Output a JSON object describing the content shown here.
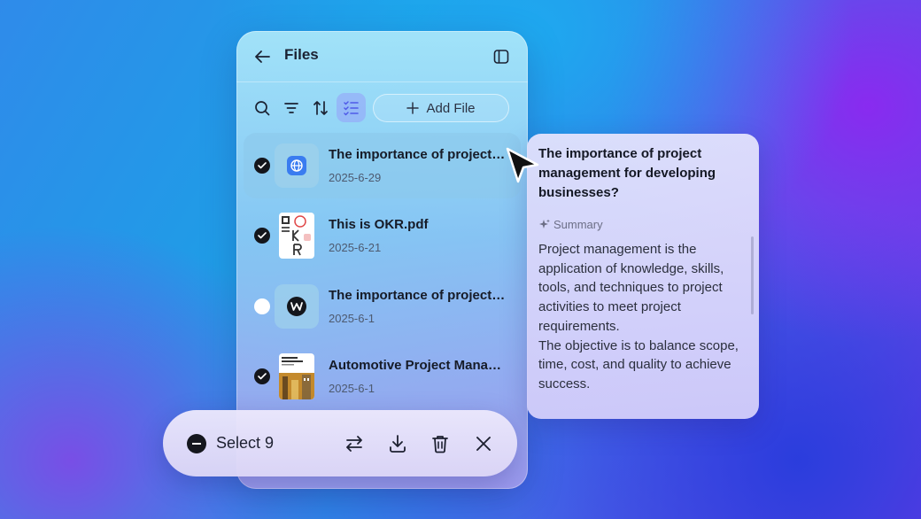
{
  "panel": {
    "title": "Files",
    "add_file_label": "Add File"
  },
  "files": [
    {
      "name": "The importance of project management for developing businesses?",
      "date": "2025-6-29",
      "checked": true,
      "thumb": "globe-app-icon"
    },
    {
      "name": "This is OKR.pdf",
      "date": "2025-6-21",
      "checked": true,
      "thumb": "okr-pdf-thumbnail"
    },
    {
      "name": "The importance of project management",
      "date": "2025-6-1",
      "checked": false,
      "thumb": "w-logo-icon"
    },
    {
      "name": "Automotive Project Management",
      "date": "2025-6-1",
      "checked": true,
      "thumb": "report-cover-thumbnail"
    }
  ],
  "popup": {
    "title": "The importance of project management for developing businesses?",
    "summary_label": "Summary",
    "summary_p1": "Project management is the application of knowledge, skills, tools, and techniques to project activities to meet project requirements.",
    "summary_p2": "The objective is to balance scope, time, cost, and quality to achieve success."
  },
  "action_bar": {
    "select_label": "Select 9"
  },
  "colors": {
    "accent_active": "#969ffa",
    "check_on": "#14161c"
  }
}
